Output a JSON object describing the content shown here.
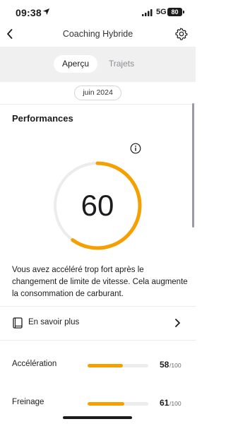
{
  "status_bar": {
    "time": "09:38",
    "network": "5G",
    "battery": "80"
  },
  "nav": {
    "title": "Coaching Hybride"
  },
  "tabs": [
    {
      "label": "Aperçu",
      "active": true
    },
    {
      "label": "Trajets",
      "active": false
    }
  ],
  "period": "juin 2024",
  "performance": {
    "title": "Performances",
    "score": "60",
    "score_fraction": 0.6,
    "description": "Vous avez accéléré trop fort après le changement de limite de vitesse. Cela augmente la consommation de carburant.",
    "learn_more": "En savoir plus"
  },
  "metrics": [
    {
      "label": "Accélération",
      "score": "58",
      "max": "/100",
      "fraction": 0.58
    },
    {
      "label": "Freinage",
      "score": "61",
      "max": "/100",
      "fraction": 0.61
    }
  ],
  "colors": {
    "accent": "#f5a000",
    "track": "#ececee"
  },
  "icons": [
    "location-arrow-icon",
    "signal-icon",
    "back-icon",
    "gear-icon",
    "info-icon",
    "book-icon",
    "chevron-right-icon"
  ]
}
